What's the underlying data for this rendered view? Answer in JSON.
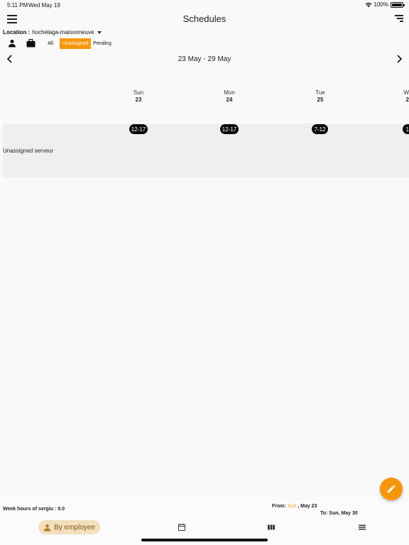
{
  "status_bar": {
    "time": "5:11 PM",
    "date": "Wed May 19",
    "battery": "100%"
  },
  "app_bar": {
    "title": "Schedules",
    "menu_icon": "menu-icon",
    "sort_icon": "sort-icon"
  },
  "location": {
    "label": "Location :",
    "value": "hochelaga-maisonneuve"
  },
  "filters": {
    "all": "All",
    "unassigned": "Unassigned",
    "pending": "Pending"
  },
  "week": {
    "range": "23 May - 29 May"
  },
  "days": [
    {
      "name": "Sun",
      "num": "23"
    },
    {
      "name": "Mon",
      "num": "24"
    },
    {
      "name": "Tue",
      "num": "25"
    },
    {
      "name": "W",
      "num": "2"
    }
  ],
  "schedule": {
    "row_label": "Unassigned serveur",
    "shifts": [
      "12-17",
      "12-17",
      "7-12",
      "1"
    ]
  },
  "footer": {
    "week_hours": "Week hours of sergiu : 9.0",
    "from_label": "From:",
    "from_day": "Sun",
    "from_date": ", May 23",
    "to_text": "To: Sun, May 30"
  },
  "bottom_nav": {
    "employee_label": "By employee"
  },
  "colors": {
    "accent": "#f7960b",
    "pill": "#0b0b0b",
    "row_bg": "#efefef"
  }
}
